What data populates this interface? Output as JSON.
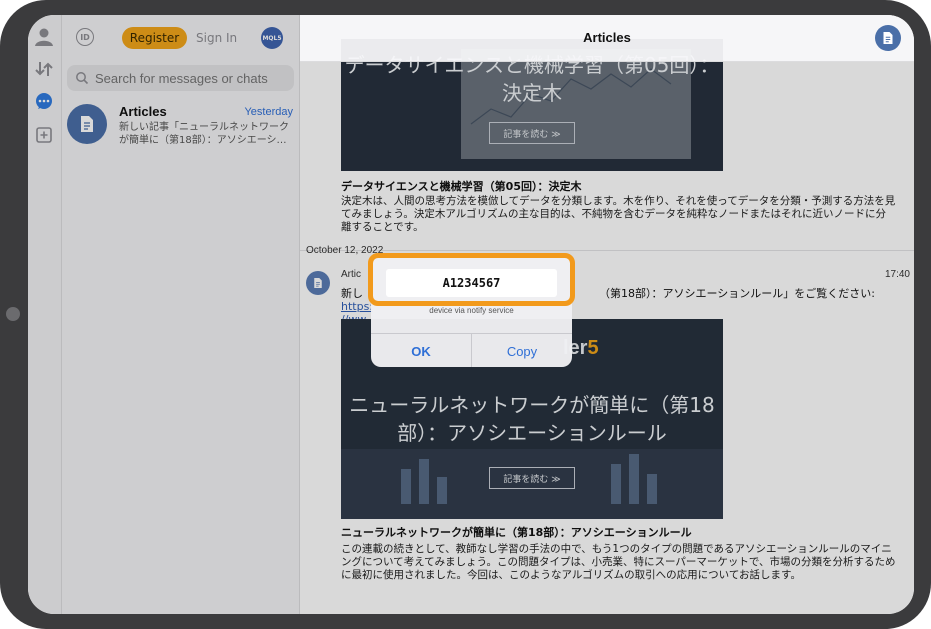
{
  "colors": {
    "accent": "#f1a51b",
    "highlight": "#f29a1c",
    "link": "#2f6fd6",
    "avatar": "#4a6fa8"
  },
  "topbar": {
    "id_badge": "ID",
    "register_label": "Register",
    "signin_label": "Sign In",
    "brand_badge": "MQL5"
  },
  "search": {
    "placeholder": "Search for messages or chats"
  },
  "chat_list": [
    {
      "title": "Articles",
      "time": "Yesterday",
      "preview": "新しい記事「ニューラルネットワークが簡単に（第18部）：アソシエーシ…",
      "icon": "document-icon"
    }
  ],
  "main": {
    "title": "Articles",
    "post1": {
      "banner_text": "データサイエンスと機械学習（第05回）：\n決定木",
      "read_button": "記事を読む ≫",
      "title": "データサイエンスと機械学習（第05回）：決定木",
      "body": "決定木は、人間の思考方法を模倣してデータを分類します。木を作り、それを使ってデータを分類・予測する方法を見てみましょう。決定木アルゴリズムの主な目的は、不純物を含むデータを純粋なノードまたはそれに近いノードに分離することです。"
    },
    "date_separator": "October 12, 2022",
    "message": {
      "sender": "Artic",
      "time": "17:40",
      "text_start": "新し",
      "text_end": "（第18部）：アソシエーションルール」をご覧ください: ",
      "link_a": "https:",
      "link_b": "//ww"
    },
    "post2": {
      "brand_fragment": "ler",
      "brand_number": "5",
      "banner_text": "ニューラルネットワークが簡単に（第18\n部）：アソシエーションルール",
      "read_button": "記事を読む ≫",
      "title": "ニューラルネットワークが簡単に（第18部）：アソシエーションルール",
      "body": "この連載の続きとして、教師なし学習の手法の中で、もう1つのタイプの問題であるアソシエーションルールのマイニングについて考えてみましょう。この問題タイプは、小売業、特にスーパーマーケットで、市場の分類を分析するために最初に使用されました。今回は、このようなアルゴリズムの取引への応用についてお話します。"
    }
  },
  "dialog": {
    "value": "A1234567",
    "message": "device via notify service",
    "ok_label": "OK",
    "copy_label": "Copy"
  }
}
